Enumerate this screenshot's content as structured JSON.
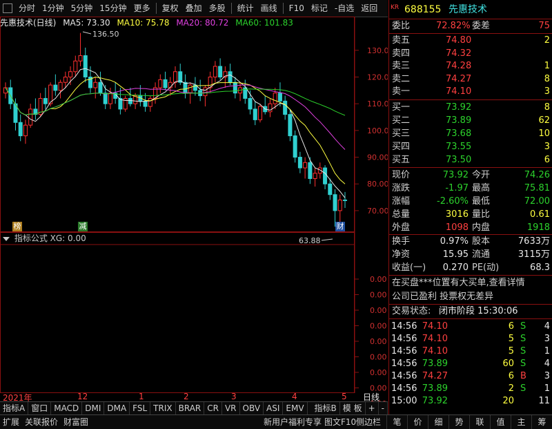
{
  "toolbar": {
    "items": [
      "分时",
      "1分钟",
      "5分钟",
      "15分钟",
      "更多",
      "复权",
      "叠加",
      "多股",
      "统计",
      "画线",
      "F10",
      "标记",
      "-自选",
      "返回"
    ]
  },
  "chart_header": {
    "name": "先惠技术(日线)",
    "ma5": "MA5: 73.30",
    "ma10": "MA10: 75.78",
    "ma20": "MA20: 80.72",
    "ma60": "MA60: 101.83"
  },
  "price_axis": [
    "130.0",
    "120.0",
    "110.0",
    "100.0",
    "90.00",
    "80.00",
    "70.00"
  ],
  "annotations": {
    "high": "136.50",
    "low": "63.88",
    "mark_left": "榜",
    "mark_mid": "减",
    "mark_right": "财"
  },
  "indicator_pane": {
    "title": "指标公式 XG: 0.00",
    "axis": [
      "0.00",
      "0.00",
      "0.00",
      "0.00",
      "0.00",
      "0.00",
      "0.00",
      "0.00",
      "0.00"
    ]
  },
  "date_axis": {
    "labels": [
      "2021年",
      "12",
      "1",
      "2",
      "3",
      "4",
      "5"
    ],
    "period": "日线"
  },
  "bottom_tabs": [
    "指标A",
    "窗口",
    "MACD",
    "DMI",
    "DMA",
    "FSL",
    "TRIX",
    "BRAR",
    "CR",
    "VR",
    "OBV",
    "ASI",
    "EMV",
    "指标B",
    "模 板",
    "+",
    "-"
  ],
  "bottom_status": {
    "left": [
      "扩展",
      "关联报价",
      "财富圈"
    ],
    "center": "新用户福利专享",
    "f10": "图文F10",
    "sidebar": "侧边栏",
    "tabs": [
      "笔",
      "价",
      "细",
      "势",
      "联",
      "值",
      "主",
      "筹"
    ]
  },
  "stock": {
    "badge": "KR",
    "code": "688155",
    "name": "先惠技术"
  },
  "order_ratio": {
    "label1": "委比",
    "value1": "72.82%",
    "label2": "委差",
    "value2": "75"
  },
  "asks": [
    {
      "label": "卖五",
      "price": "74.80",
      "vol": "2"
    },
    {
      "label": "卖四",
      "price": "74.32",
      "vol": ""
    },
    {
      "label": "卖三",
      "price": "74.28",
      "vol": "1"
    },
    {
      "label": "卖二",
      "price": "74.27",
      "vol": "8"
    },
    {
      "label": "卖一",
      "price": "74.10",
      "vol": "3"
    }
  ],
  "bids": [
    {
      "label": "买一",
      "price": "73.92",
      "vol": "8"
    },
    {
      "label": "买二",
      "price": "73.89",
      "vol": "62"
    },
    {
      "label": "买三",
      "price": "73.68",
      "vol": "10"
    },
    {
      "label": "买四",
      "price": "73.55",
      "vol": "3"
    },
    {
      "label": "买五",
      "price": "73.50",
      "vol": "6"
    }
  ],
  "quote": [
    {
      "l1": "现价",
      "v1": "73.92",
      "c1": "green",
      "l2": "今开",
      "v2": "74.26",
      "c2": "green"
    },
    {
      "l1": "涨跌",
      "v1": "-1.97",
      "c1": "green",
      "l2": "最高",
      "v2": "75.81",
      "c2": "green"
    },
    {
      "l1": "涨幅",
      "v1": "-2.60%",
      "c1": "green",
      "l2": "最低",
      "v2": "72.00",
      "c2": "green"
    },
    {
      "l1": "总量",
      "v1": "3016",
      "c1": "yellow",
      "l2": "量比",
      "v2": "0.61",
      "c2": "yellow"
    },
    {
      "l1": "外盘",
      "v1": "1098",
      "c1": "red",
      "l2": "内盘",
      "v2": "1918",
      "c2": "green"
    }
  ],
  "finance": [
    {
      "l1": "换手",
      "v1": "0.97%",
      "l2": "股本",
      "v2": "7633万"
    },
    {
      "l1": "净资",
      "v1": "15.95",
      "l2": "流通",
      "v2": "3115万"
    },
    {
      "l1": "收益(一)",
      "v1": "0.270",
      "l2": "PE(动)",
      "v2": "68.3"
    }
  ],
  "news": [
    "在买盘***位置有大买单,查看详情",
    "公司已盈利 投票权无差异"
  ],
  "trade_status": {
    "label": "交易状态:",
    "value": "闭市阶段 15:30:06"
  },
  "ticks": [
    {
      "time": "14:56",
      "price": "74.10",
      "pc": "red",
      "vol": "6",
      "bs": "S",
      "n": "4"
    },
    {
      "time": "14:56",
      "price": "74.10",
      "pc": "red",
      "vol": "5",
      "bs": "S",
      "n": "3"
    },
    {
      "time": "14:56",
      "price": "74.10",
      "pc": "red",
      "vol": "5",
      "bs": "S",
      "n": "1"
    },
    {
      "time": "14:56",
      "price": "73.89",
      "pc": "green",
      "vol": "60",
      "bs": "S",
      "n": "4"
    },
    {
      "time": "14:56",
      "price": "74.27",
      "pc": "red",
      "vol": "6",
      "bs": "B",
      "n": "3"
    },
    {
      "time": "14:56",
      "price": "73.89",
      "pc": "green",
      "vol": "2",
      "bs": "S",
      "n": "1"
    },
    {
      "time": "15:00",
      "price": "73.92",
      "pc": "green",
      "vol": "20",
      "bs": "",
      "n": "11"
    }
  ],
  "chart_data": {
    "type": "candlestick",
    "ylim": [
      63,
      139
    ],
    "candles": [
      [
        114,
        118,
        112,
        116
      ],
      [
        116,
        119,
        108,
        110
      ],
      [
        110,
        112,
        100,
        103
      ],
      [
        103,
        106,
        96,
        98
      ],
      [
        98,
        104,
        95,
        102
      ],
      [
        102,
        110,
        101,
        108
      ],
      [
        108,
        112,
        104,
        106
      ],
      [
        106,
        114,
        105,
        112
      ],
      [
        112,
        116,
        108,
        110
      ],
      [
        110,
        118,
        109,
        117
      ],
      [
        117,
        121,
        113,
        115
      ],
      [
        115,
        119,
        112,
        118
      ],
      [
        118,
        122,
        116,
        120
      ],
      [
        120,
        124,
        117,
        122
      ],
      [
        122,
        128,
        120,
        126
      ],
      [
        126,
        136.5,
        124,
        128
      ],
      [
        128,
        131,
        118,
        120
      ],
      [
        120,
        124,
        114,
        116
      ],
      [
        116,
        120,
        112,
        118
      ],
      [
        118,
        122,
        113,
        114
      ],
      [
        114,
        117,
        108,
        110
      ],
      [
        110,
        116,
        108,
        114
      ],
      [
        114,
        118,
        110,
        112
      ],
      [
        112,
        116,
        106,
        108
      ],
      [
        108,
        113,
        107,
        112
      ],
      [
        112,
        116,
        109,
        110
      ],
      [
        110,
        114,
        108,
        113
      ],
      [
        113,
        117,
        109,
        111
      ],
      [
        111,
        114,
        107,
        109
      ],
      [
        109,
        113,
        107,
        112
      ],
      [
        112,
        118,
        110,
        116
      ],
      [
        116,
        121,
        114,
        119
      ],
      [
        119,
        122,
        115,
        116
      ],
      [
        116,
        120,
        113,
        118
      ],
      [
        118,
        124,
        116,
        122
      ],
      [
        122,
        125,
        117,
        118
      ],
      [
        118,
        121,
        112,
        114
      ],
      [
        114,
        118,
        110,
        117
      ],
      [
        117,
        120,
        113,
        115
      ],
      [
        115,
        119,
        111,
        113
      ],
      [
        113,
        117,
        109,
        116
      ],
      [
        116,
        122,
        114,
        120
      ],
      [
        120,
        126,
        118,
        124
      ],
      [
        124,
        127,
        119,
        120
      ],
      [
        120,
        124,
        116,
        122
      ],
      [
        122,
        125,
        117,
        118
      ],
      [
        118,
        120,
        112,
        114
      ],
      [
        114,
        118,
        111,
        116
      ],
      [
        116,
        119,
        110,
        112
      ],
      [
        112,
        115,
        106,
        108
      ],
      [
        108,
        111,
        102,
        104
      ],
      [
        104,
        110,
        103,
        109
      ],
      [
        109,
        113,
        106,
        107
      ],
      [
        107,
        112,
        105,
        110
      ],
      [
        110,
        116,
        108,
        114
      ],
      [
        114,
        118,
        109,
        111
      ],
      [
        111,
        113,
        104,
        106
      ],
      [
        106,
        108,
        96,
        98
      ],
      [
        98,
        100,
        88,
        90
      ],
      [
        90,
        92,
        84,
        86
      ],
      [
        86,
        90,
        82,
        88
      ],
      [
        88,
        90,
        80,
        82
      ],
      [
        82,
        86,
        79,
        84
      ],
      [
        84,
        88,
        82,
        86
      ],
      [
        86,
        87,
        78,
        80
      ],
      [
        80,
        82,
        74,
        76
      ],
      [
        76,
        78,
        64,
        70
      ],
      [
        70,
        76,
        63.88,
        74
      ],
      [
        74,
        77,
        71,
        73.9
      ]
    ]
  }
}
